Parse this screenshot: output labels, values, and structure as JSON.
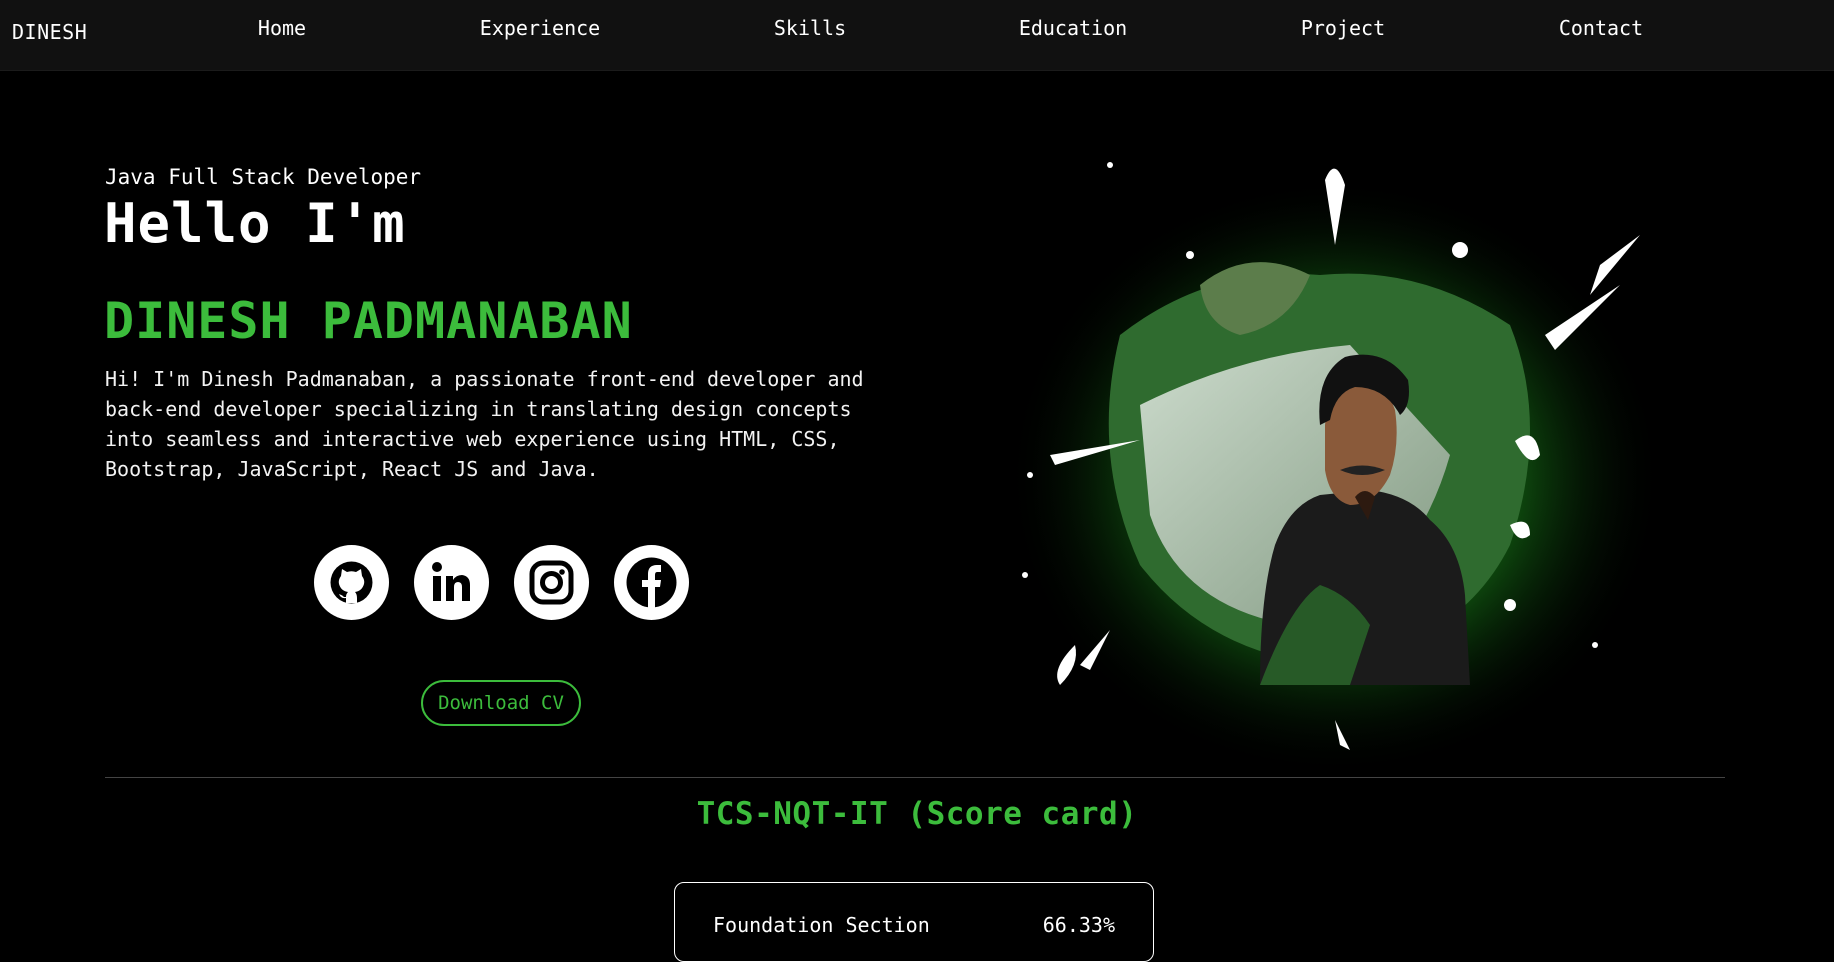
{
  "nav": {
    "brand": "DINESH",
    "items": [
      "Home",
      "Experience",
      "Skills",
      "Education",
      "Project",
      "Contact"
    ]
  },
  "hero": {
    "role": "Java Full Stack Developer",
    "greeting": "Hello I'm",
    "name": "DINESH PADMANABAN",
    "bio": "Hi! I'm Dinesh Padmanaban, a passionate front-end developer and back-end developer specializing in translating design concepts into seamless and interactive web experience using HTML, CSS, Bootstrap, JavaScript, React JS and Java.",
    "social_icons": [
      "github-icon",
      "linkedin-icon",
      "instagram-icon",
      "facebook-icon"
    ],
    "cv_button": "Download CV",
    "accent_color": "#3cbc3c"
  },
  "scorecard": {
    "title": "TCS-NQT-IT (Score card)",
    "rows": [
      {
        "label": "Foundation Section",
        "value": "66.33%"
      }
    ]
  }
}
